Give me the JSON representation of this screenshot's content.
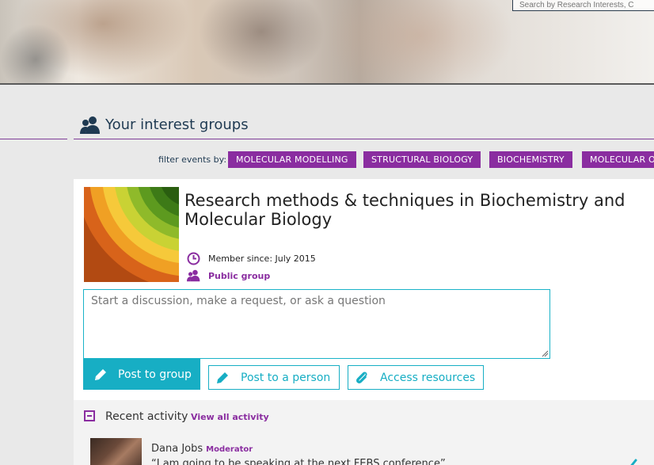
{
  "search": {
    "placeholder": "Search by Research Interests, C"
  },
  "section": {
    "title": "Your interest groups",
    "icon": "people-icon"
  },
  "filter": {
    "label": "filter events by:",
    "tags": [
      "MOLECULAR MODELLING",
      "STRUCTURAL BIOLOGY",
      "BIOCHEMISTRY",
      "MOLECULAR O"
    ]
  },
  "group": {
    "title": "Research methods & techniques in Biochemistry and Molecular Biology",
    "member_since": "Member since: July 2015",
    "visibility": "Public group",
    "discussion_placeholder": "Start a discussion, make a request, or ask a question",
    "post_to_group": "Post to group",
    "post_to_person": "Post to a person",
    "access_resources": "Access resources"
  },
  "activity": {
    "title": "Recent activity",
    "view_all": "View all activity",
    "author": "Dana Jobs",
    "role": "Moderator",
    "quote": "“I am going to be speaking at the next FEBS conference”"
  },
  "colors": {
    "accent_purple": "#8a2da0",
    "accent_teal": "#17aec4",
    "title_navy": "#1f3a52"
  }
}
